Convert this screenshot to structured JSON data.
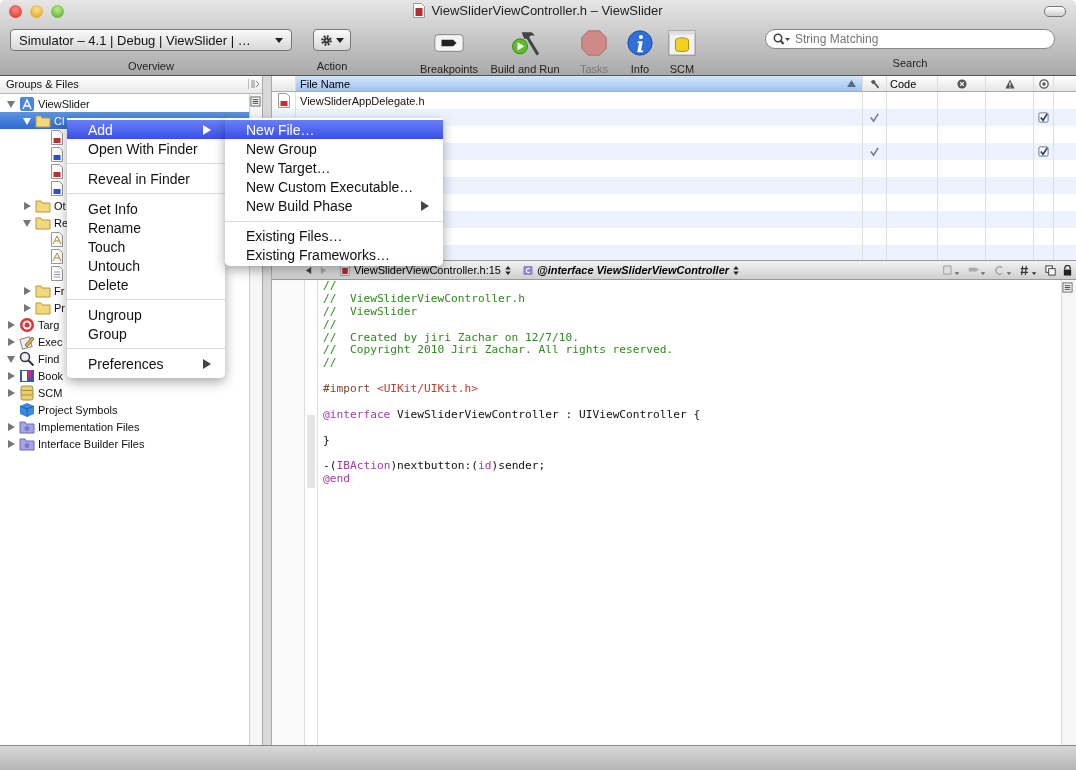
{
  "window": {
    "title": "ViewSliderViewController.h – ViewSlider"
  },
  "toolbar": [
    {
      "kind": "overview",
      "label": "Overview",
      "value": "Simulator – 4.1 | Debug | ViewSlider | …"
    },
    {
      "kind": "action",
      "label": "Action"
    },
    {
      "kind": "breakpoints",
      "label": "Breakpoints",
      "disabled": false
    },
    {
      "kind": "build",
      "label": "Build and Run",
      "disabled": false
    },
    {
      "kind": "tasks",
      "label": "Tasks",
      "disabled": true
    },
    {
      "kind": "info",
      "label": "Info",
      "disabled": false
    },
    {
      "kind": "scm",
      "label": "SCM",
      "disabled": false
    },
    {
      "kind": "search",
      "label": "Search",
      "placeholder": "String Matching"
    }
  ],
  "sidebar": {
    "title": "Groups & Files",
    "tree": [
      {
        "label": "ViewSlider",
        "kind": "project",
        "expanded": true,
        "selected": false,
        "children": [
          {
            "label": "Cl",
            "kind": "folder",
            "expanded": true,
            "selected": true,
            "children": [
              {
                "kind": "h",
                "selected": false
              },
              {
                "kind": "m",
                "selected": false
              },
              {
                "kind": "h",
                "selected": false
              },
              {
                "kind": "m",
                "selected": false
              }
            ]
          },
          {
            "label": "Ot",
            "kind": "folder",
            "expanded": false,
            "selected": false
          },
          {
            "label": "Re",
            "kind": "folder",
            "expanded": true,
            "selected": false,
            "children": [
              {
                "kind": "xib",
                "selected": false
              },
              {
                "kind": "xib",
                "selected": false
              },
              {
                "kind": "plist",
                "selected": false
              }
            ]
          },
          {
            "label": "Fr",
            "kind": "folder",
            "expanded": false,
            "selected": false
          },
          {
            "label": "Pr",
            "kind": "folder",
            "expanded": false,
            "selected": false
          }
        ]
      },
      {
        "label": "Targ",
        "kind": "target",
        "expanded": false,
        "selected": false
      },
      {
        "label": "Exec",
        "kind": "executable",
        "expanded": false,
        "selected": false
      },
      {
        "label": "Find",
        "kind": "find",
        "expanded": true,
        "selected": false
      },
      {
        "label": "Book",
        "kind": "book",
        "expanded": false,
        "selected": false
      },
      {
        "label": "SCM",
        "kind": "scm",
        "expanded": false,
        "selected": false
      },
      {
        "label": "Project Symbols",
        "kind": "symbols",
        "selected": false
      },
      {
        "label": "Implementation Files",
        "kind": "smart",
        "expanded": false,
        "selected": false
      },
      {
        "label": "Interface Builder Files",
        "kind": "smart",
        "expanded": false,
        "selected": false
      }
    ]
  },
  "file_table": {
    "columns": [
      {
        "kind": "name",
        "label": "File Name",
        "sorted": true
      },
      {
        "kind": "build"
      },
      {
        "kind": "code",
        "label": "Code"
      },
      {
        "kind": "errors"
      },
      {
        "kind": "warnings"
      },
      {
        "kind": "target"
      }
    ],
    "rows": [
      {
        "name": "ViewSliderAppDelegate.h",
        "kind": "h",
        "build": false,
        "target": false
      },
      {
        "build": true,
        "target": true
      },
      {
        "build": false,
        "target": false
      },
      {
        "build": true,
        "target": true
      },
      {
        "build": false,
        "target": false
      },
      {
        "build": false,
        "target": false
      },
      {
        "build": false,
        "target": false
      },
      {
        "build": false,
        "target": false
      },
      {
        "build": false,
        "target": false
      },
      {
        "build": false,
        "target": false
      }
    ]
  },
  "editor": {
    "file": "ViewSliderViewController.h:15",
    "symbol": "@interface ViewSliderViewController",
    "lines": [
      {
        "kind": "code",
        "segments": [
          {
            "kind": "comment",
            "text": "//"
          }
        ]
      },
      {
        "kind": "code",
        "segments": [
          {
            "kind": "comment",
            "text": "//  ViewSliderViewController.h"
          }
        ]
      },
      {
        "kind": "code",
        "segments": [
          {
            "kind": "comment",
            "text": "//  ViewSlider"
          }
        ]
      },
      {
        "kind": "code",
        "segments": [
          {
            "kind": "comment",
            "text": "//"
          }
        ]
      },
      {
        "kind": "code",
        "segments": [
          {
            "kind": "comment",
            "text": "//  Created by jiri Zachar on 12/7/10."
          }
        ]
      },
      {
        "kind": "code",
        "segments": [
          {
            "kind": "comment",
            "text": "//  Copyright 2010 Jiri Zachar. All rights reserved."
          }
        ]
      },
      {
        "kind": "code",
        "segments": [
          {
            "kind": "comment",
            "text": "//"
          }
        ]
      },
      {
        "kind": "blank"
      },
      {
        "kind": "code",
        "segments": [
          {
            "kind": "directive",
            "text": "#import "
          },
          {
            "kind": "string",
            "text": "<UIKit/UIKit.h>"
          }
        ]
      },
      {
        "kind": "blank"
      },
      {
        "kind": "code",
        "segments": [
          {
            "kind": "keyword",
            "text": "@interface"
          },
          {
            "kind": "plain",
            "text": " ViewSliderViewController : UIViewController {"
          }
        ]
      },
      {
        "kind": "blank"
      },
      {
        "kind": "code",
        "segments": [
          {
            "kind": "plain",
            "text": "}"
          }
        ]
      },
      {
        "kind": "blank"
      },
      {
        "kind": "code",
        "segments": [
          {
            "kind": "plain",
            "text": "-("
          },
          {
            "kind": "keyword",
            "text": "IBAction"
          },
          {
            "kind": "plain",
            "text": ")nextbutton:("
          },
          {
            "kind": "keyword",
            "text": "id"
          },
          {
            "kind": "plain",
            "text": ")sender;"
          }
        ]
      },
      {
        "kind": "code",
        "segments": [
          {
            "kind": "keyword",
            "text": "@end"
          }
        ]
      }
    ]
  },
  "context_menu": {
    "items": [
      {
        "kind": "item",
        "label": "Add",
        "submenu": true,
        "selected": true
      },
      {
        "kind": "item",
        "label": "Open With Finder",
        "submenu": false,
        "selected": false
      },
      {
        "kind": "separator"
      },
      {
        "kind": "item",
        "label": "Reveal in Finder",
        "submenu": false,
        "selected": false
      },
      {
        "kind": "separator"
      },
      {
        "kind": "item",
        "label": "Get Info",
        "submenu": false,
        "selected": false
      },
      {
        "kind": "item",
        "label": "Rename",
        "submenu": false,
        "selected": false
      },
      {
        "kind": "item",
        "label": "Touch",
        "submenu": false,
        "selected": false
      },
      {
        "kind": "item",
        "label": "Untouch",
        "submenu": false,
        "selected": false
      },
      {
        "kind": "item",
        "label": "Delete",
        "submenu": false,
        "selected": false
      },
      {
        "kind": "separator"
      },
      {
        "kind": "item",
        "label": "Ungroup",
        "submenu": false,
        "selected": false
      },
      {
        "kind": "item",
        "label": "Group",
        "submenu": false,
        "selected": false
      },
      {
        "kind": "separator"
      },
      {
        "kind": "item",
        "label": "Preferences",
        "submenu": true,
        "selected": false
      }
    ]
  },
  "submenu": {
    "items": [
      {
        "kind": "item",
        "label": "New File…",
        "submenu": false,
        "selected": true
      },
      {
        "kind": "item",
        "label": "New Group",
        "submenu": false,
        "selected": false
      },
      {
        "kind": "item",
        "label": "New Target…",
        "submenu": false,
        "selected": false
      },
      {
        "kind": "item",
        "label": "New Custom Executable…",
        "submenu": false,
        "selected": false
      },
      {
        "kind": "item",
        "label": "New Build Phase",
        "submenu": true,
        "selected": false
      },
      {
        "kind": "separator"
      },
      {
        "kind": "item",
        "label": "Existing Files…",
        "submenu": false,
        "selected": false
      },
      {
        "kind": "item",
        "label": "Existing Frameworks…",
        "submenu": false,
        "selected": false
      }
    ]
  }
}
